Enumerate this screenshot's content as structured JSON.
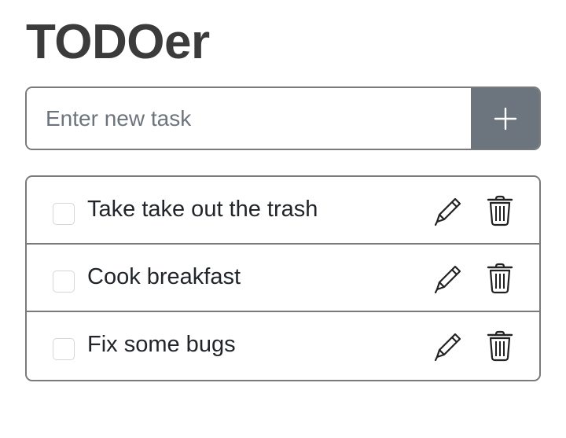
{
  "app": {
    "title": "TODOer"
  },
  "new_task": {
    "placeholder": "Enter new task",
    "value": ""
  },
  "icons": {
    "add": "plus-icon",
    "edit": "pencil-icon",
    "delete": "trash-icon"
  },
  "colors": {
    "add_button": "#6c757d",
    "border": "#7a7a7a",
    "title": "#3b3b3b"
  },
  "tasks": [
    {
      "label": "Take take out the trash",
      "done": false
    },
    {
      "label": "Cook breakfast",
      "done": false
    },
    {
      "label": "Fix some bugs",
      "done": false
    }
  ]
}
